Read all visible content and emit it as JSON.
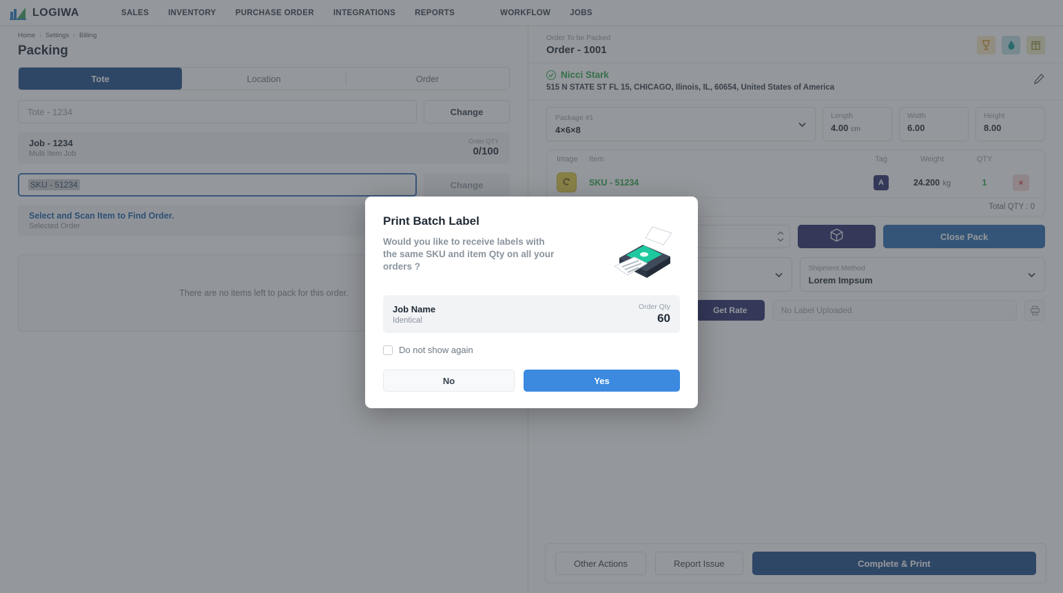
{
  "brand": {
    "name": "LOGIWA",
    "logo_icon": "logiwa-bars-logo"
  },
  "topnav": {
    "items": [
      {
        "label": "SALES"
      },
      {
        "label": "INVENTORY"
      },
      {
        "label": "PURCHASE ORDER"
      },
      {
        "label": "INTEGRATIONS"
      },
      {
        "label": "REPORTS"
      },
      {
        "label": "WORKFLOW"
      },
      {
        "label": "JOBS"
      }
    ]
  },
  "breadcrumb": {
    "items": [
      {
        "label": "Home"
      },
      {
        "label": "Settings"
      },
      {
        "label": "Billing"
      }
    ],
    "separator": "›"
  },
  "page": {
    "title": "Packing"
  },
  "tabs": [
    {
      "label": "Tote",
      "active": true
    },
    {
      "label": "Location",
      "active": false
    },
    {
      "label": "Order",
      "active": false
    }
  ],
  "left": {
    "tote_input": {
      "placeholder": "Tote - 1234",
      "value": ""
    },
    "change_button": "Change",
    "job_card": {
      "title": "Job - 1234",
      "subtitle": "Multi Item Job",
      "qty_label": "Order QTY",
      "qty_value": "0/100"
    },
    "sku_input": {
      "value": "SKU - 51234",
      "focused": true
    },
    "sku_change_button": "Change",
    "order_card": {
      "link": "Select and Scan Item to Find Order.",
      "subtitle": "Selected Order"
    },
    "empty_message": "There are no items left to pack for this order."
  },
  "right": {
    "order_label": "Order To be Packed",
    "order_number": "Order - 1001",
    "badges": [
      {
        "name": "fragile-icon",
        "color": "#fbe9c6"
      },
      {
        "name": "liquid-icon",
        "color": "#bfe3e6"
      },
      {
        "name": "stackable-icon",
        "color": "#ecebc4"
      }
    ],
    "customer": {
      "name": "Nicci Stark",
      "address": "515 N STATE ST FL 15, CHICAGO, Ilinois, IL, 60654, United States of America",
      "verified_icon": "check-circle-icon",
      "edit_icon": "pencil-icon"
    },
    "package": {
      "label": "Package #1",
      "value": "4×6×8",
      "length": {
        "label": "Length",
        "value": "4.00",
        "unit": "cm"
      },
      "width": {
        "label": "Width",
        "value": "6.00"
      },
      "height": {
        "label": "Height",
        "value": "8.00"
      }
    },
    "items_table": {
      "columns": [
        "Image",
        "Item",
        "Tag",
        "Weight",
        "QTY"
      ],
      "rows": [
        {
          "image_icon": "item-thumbnail",
          "item": "SKU - 51234",
          "tag": "A",
          "weight": "24.200",
          "weight_unit": "kg",
          "qty": "1",
          "delete_icon": "remove-icon"
        }
      ],
      "footer": "Total QTY : 0"
    },
    "pack_actions": {
      "qty_stepper": {
        "value": ""
      },
      "box_button_icon": "package-box-icon",
      "close_pack": "Close Pack"
    },
    "shipment": {
      "carrier_value": "",
      "method_label": "Shipment Method",
      "method_value": "Lorem Impsum"
    },
    "rate": {
      "get_rate": "Get Rate",
      "label_status": "No Label Uploaded",
      "print_icon": "printer-icon"
    },
    "bottom_bar": {
      "other_actions": "Other Actions",
      "report_issue": "Report Issue",
      "complete_print": "Complete & Print"
    }
  },
  "modal": {
    "title": "Print Batch Label",
    "question": "Would you like to receive labels with the same SKU and item Qty on all your orders ?",
    "illustration": "printer-illustration",
    "job": {
      "name_label": "Job Name",
      "name_value": "Identical",
      "qty_label": "Order Qty",
      "qty_value": "60"
    },
    "dont_show_again": "Do not show again",
    "no_button": "No",
    "yes_button": "Yes"
  },
  "colors": {
    "primary_blue": "#1f4e89",
    "accent_blue": "#3b8ae0",
    "navy": "#2b2e6e",
    "green": "#2ba84a",
    "close_pack_blue": "#2a6db0"
  }
}
